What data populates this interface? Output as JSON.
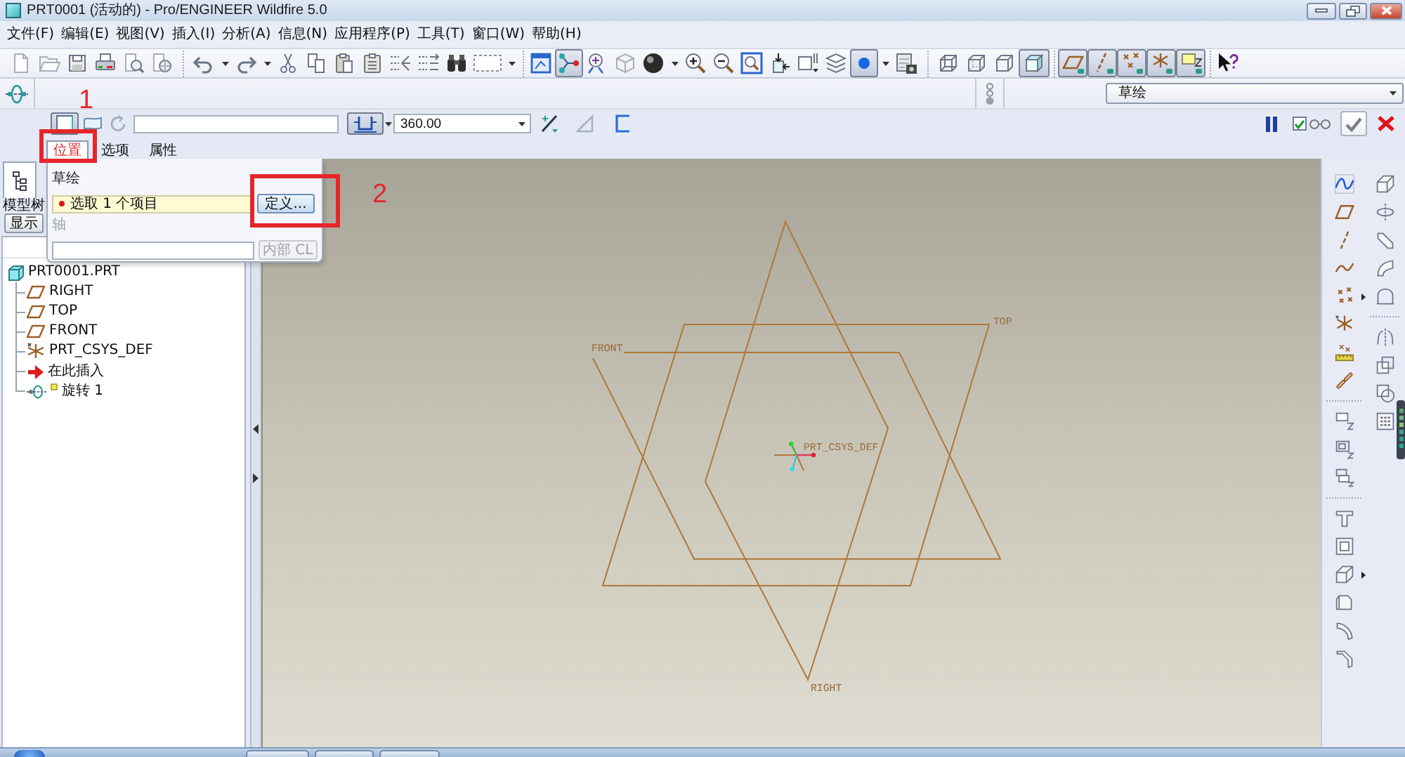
{
  "window": {
    "title": "PRT0001 (活动的) - Pro/ENGINEER Wildfire 5.0"
  },
  "menu": [
    "文件(F)",
    "编辑(E)",
    "视图(V)",
    "插入(I)",
    "分析(A)",
    "信息(N)",
    "应用程序(P)",
    "工具(T)",
    "窗口(W)",
    "帮助(H)"
  ],
  "toolbar": [
    {
      "on": false
    },
    {
      "on": false
    },
    {
      "on": false
    },
    {
      "on": false
    },
    {
      "on": false
    },
    {
      "on": false
    },
    {
      "on": false
    },
    {
      "on": false
    },
    {
      "on": false
    },
    {
      "on": false
    },
    {
      "on": false
    },
    {
      "on": false
    },
    {
      "on": false
    },
    {
      "on": false
    },
    {
      "on": false
    },
    {
      "on": false
    },
    {
      "on": false
    },
    {
      "on": true
    },
    {
      "on": false
    },
    {
      "on": false
    },
    {
      "on": false
    },
    {
      "on": false
    },
    {
      "on": false
    },
    {
      "on": false
    },
    {
      "on": false
    },
    {
      "on": false
    },
    {
      "on": false
    },
    {
      "on": true
    },
    {
      "on": false
    },
    {
      "on": false
    },
    {
      "on": false
    },
    {
      "on": false
    },
    {
      "on": true
    },
    {
      "on": true
    },
    {
      "on": true
    },
    {
      "on": true
    },
    {
      "on": true
    },
    {
      "on": true
    },
    {
      "on": false
    }
  ],
  "filter": {
    "value": "草绘"
  },
  "dashboard": {
    "type_buttons": [
      {
        "on": true
      },
      {
        "on": false
      }
    ],
    "angle_mode": {
      "on": true
    },
    "angle_value": "360.00",
    "preview_checked": true
  },
  "dashboard_tabs": [
    {
      "label": "位置",
      "selected": true
    },
    {
      "label": "选项",
      "selected": false
    },
    {
      "label": "属性",
      "selected": false
    }
  ],
  "placement_panel": {
    "sketch_label": "草绘",
    "sketch_selection": "选取 1 个项目",
    "define_button": "定义...",
    "axis_label": "轴",
    "axis_button": "内部 CL",
    "axis_disabled": true
  },
  "model_tree": {
    "title": "模型树",
    "show_button": "显示",
    "items": [
      {
        "label": "PRT0001.PRT",
        "kind": "part",
        "children": [
          {
            "label": "RIGHT",
            "kind": "datum_plane",
            "editing": false
          },
          {
            "label": "TOP",
            "kind": "datum_plane",
            "editing": false
          },
          {
            "label": "FRONT",
            "kind": "datum_plane",
            "editing": false
          },
          {
            "label": "PRT_CSYS_DEF",
            "kind": "csys",
            "editing": false
          },
          {
            "label": "在此插入",
            "kind": "insert_here",
            "editing": false
          },
          {
            "label": "旋转 1",
            "kind": "revolve",
            "editing": true
          }
        ]
      }
    ]
  },
  "graphics": {
    "datum_planes": [
      {
        "label": "RIGHT"
      },
      {
        "label": "TOP"
      },
      {
        "label": "FRONT"
      }
    ],
    "csys_label": "PRT_CSYS_DEF"
  },
  "annotations": [
    {
      "label": "1"
    },
    {
      "label": "2"
    }
  ]
}
